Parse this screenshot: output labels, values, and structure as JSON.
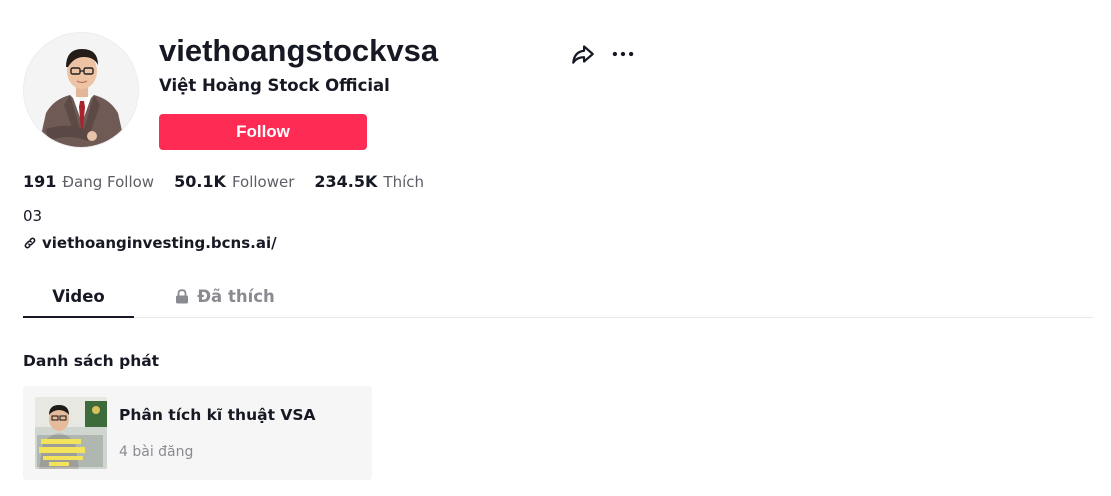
{
  "profile": {
    "username": "viethoangstockvsa",
    "nickname": "Việt Hoàng Stock Official",
    "follow_label": "Follow",
    "bio": "03",
    "link": "viethoanginvesting.bcns.ai/"
  },
  "stats": [
    {
      "value": "191",
      "label": "Đang Follow"
    },
    {
      "value": "50.1K",
      "label": "Follower"
    },
    {
      "value": "234.5K",
      "label": "Thích"
    }
  ],
  "tabs": [
    {
      "label": "Video",
      "active": true
    },
    {
      "label": "Đã thích",
      "active": false,
      "icon": "lock-icon"
    }
  ],
  "playlists": {
    "heading": "Danh sách phát",
    "items": [
      {
        "title": "Phân tích kĩ thuật VSA",
        "count": "4 bài đăng"
      }
    ]
  },
  "icons": {
    "share": "share-icon",
    "more": "more-icon",
    "link": "link-icon",
    "lock": "lock-icon"
  },
  "colors": {
    "accent": "#fe2c55",
    "text_primary": "#161823",
    "text_secondary": "#5e5f66",
    "text_muted": "#8a8b91",
    "divider": "#e8e8e9",
    "card_bg": "#f6f6f6"
  }
}
